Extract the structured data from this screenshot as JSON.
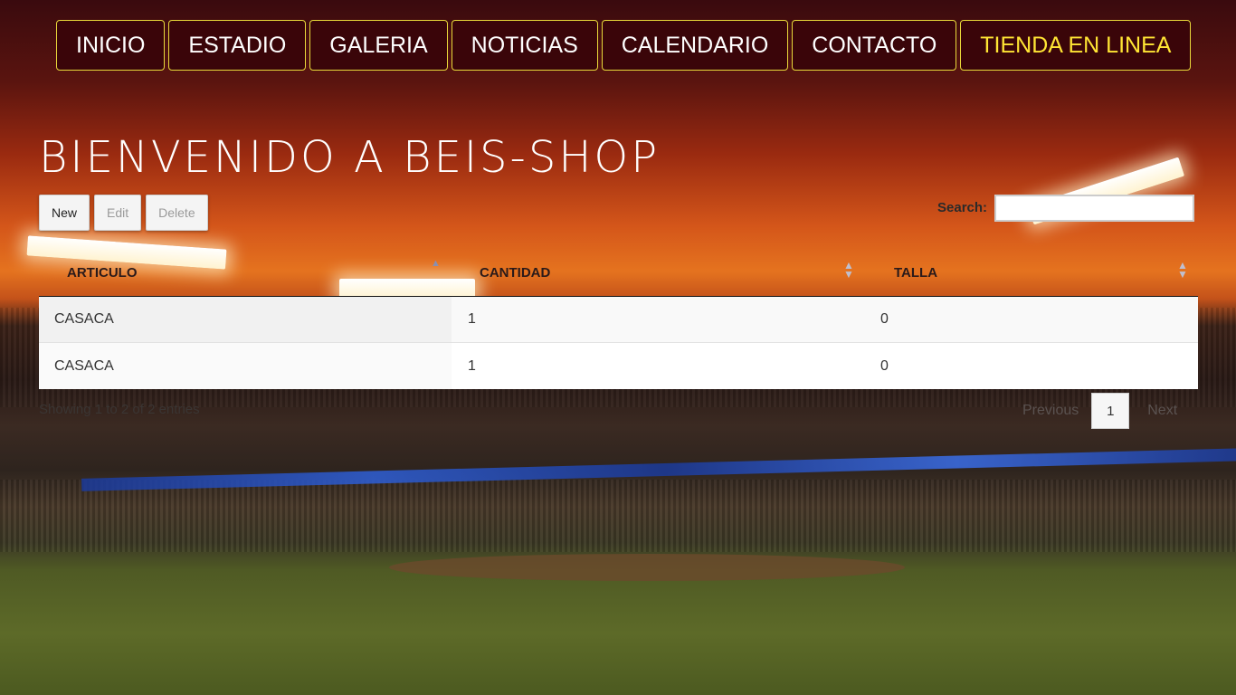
{
  "nav": {
    "items": [
      {
        "label": "INICIO"
      },
      {
        "label": "ESTADIO"
      },
      {
        "label": "GALERIA"
      },
      {
        "label": "NOTICIAS"
      },
      {
        "label": "CALENDARIO"
      },
      {
        "label": "CONTACTO"
      },
      {
        "label": "TIENDA EN LINEA"
      }
    ]
  },
  "page": {
    "title": "BIENVENIDO A BEIS-SHOP"
  },
  "toolbar": {
    "new_label": "New",
    "edit_label": "Edit",
    "delete_label": "Delete"
  },
  "search": {
    "label": "Search:",
    "value": ""
  },
  "table": {
    "columns": [
      "ARTICULO",
      "CANTIDAD",
      "TALLA"
    ],
    "rows": [
      [
        "CASACA",
        "1",
        "0"
      ],
      [
        "CASACA",
        "1",
        "0"
      ]
    ],
    "info": "Showing 1 to 2 of 2 entries"
  },
  "pagination": {
    "previous": "Previous",
    "current_page": "1",
    "next": "Next"
  },
  "colors": {
    "nav_border": "#e9d93a",
    "nav_bg": "#3a0509",
    "shop_text": "#ffe534"
  }
}
